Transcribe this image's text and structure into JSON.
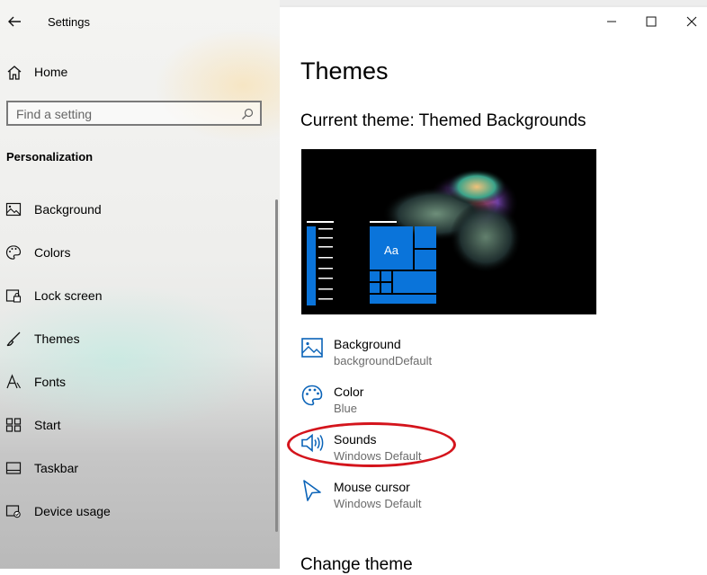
{
  "window": {
    "app_title": "Settings",
    "back_icon": "back-arrow-icon",
    "controls": {
      "minimize_icon": "minimize-icon",
      "maximize_icon": "maximize-icon",
      "close_icon": "close-icon"
    }
  },
  "sidebar": {
    "home_label": "Home",
    "search_placeholder": "Find a setting",
    "search_icon": "search-icon",
    "section_heading": "Personalization",
    "items": [
      {
        "label": "Background",
        "icon": "picture-icon"
      },
      {
        "label": "Colors",
        "icon": "palette-icon"
      },
      {
        "label": "Lock screen",
        "icon": "lock-screen-icon"
      },
      {
        "label": "Themes",
        "icon": "brush-icon",
        "selected": true
      },
      {
        "label": "Fonts",
        "icon": "fonts-icon"
      },
      {
        "label": "Start",
        "icon": "start-icon"
      },
      {
        "label": "Taskbar",
        "icon": "taskbar-icon"
      },
      {
        "label": "Device usage",
        "icon": "device-usage-icon"
      }
    ]
  },
  "main": {
    "page_title": "Themes",
    "current_theme": "Current theme: Themed Backgrounds",
    "preview": {
      "sample_text": "Aa",
      "accent_color": "#0a74da"
    },
    "properties": [
      {
        "title": "Background",
        "value": "backgroundDefault",
        "icon": "picture-icon"
      },
      {
        "title": "Color",
        "value": "Blue",
        "icon": "palette-icon"
      },
      {
        "title": "Sounds",
        "value": "Windows Default",
        "icon": "speaker-icon",
        "annotated": true
      },
      {
        "title": "Mouse cursor",
        "value": "Windows Default",
        "icon": "cursor-icon"
      }
    ],
    "change_theme_heading": "Change theme"
  },
  "annotation": {
    "color": "#d4141c",
    "target": "Sounds"
  }
}
